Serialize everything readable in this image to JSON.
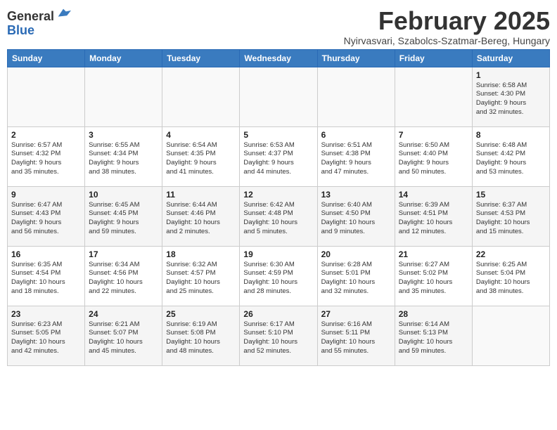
{
  "header": {
    "logo_general": "General",
    "logo_blue": "Blue",
    "month_title": "February 2025",
    "subtitle": "Nyirvasvari, Szabolcs-Szatmar-Bereg, Hungary"
  },
  "days_of_week": [
    "Sunday",
    "Monday",
    "Tuesday",
    "Wednesday",
    "Thursday",
    "Friday",
    "Saturday"
  ],
  "weeks": [
    [
      {
        "day": "",
        "info": ""
      },
      {
        "day": "",
        "info": ""
      },
      {
        "day": "",
        "info": ""
      },
      {
        "day": "",
        "info": ""
      },
      {
        "day": "",
        "info": ""
      },
      {
        "day": "",
        "info": ""
      },
      {
        "day": "1",
        "info": "Sunrise: 6:58 AM\nSunset: 4:30 PM\nDaylight: 9 hours\nand 32 minutes."
      }
    ],
    [
      {
        "day": "2",
        "info": "Sunrise: 6:57 AM\nSunset: 4:32 PM\nDaylight: 9 hours\nand 35 minutes."
      },
      {
        "day": "3",
        "info": "Sunrise: 6:55 AM\nSunset: 4:34 PM\nDaylight: 9 hours\nand 38 minutes."
      },
      {
        "day": "4",
        "info": "Sunrise: 6:54 AM\nSunset: 4:35 PM\nDaylight: 9 hours\nand 41 minutes."
      },
      {
        "day": "5",
        "info": "Sunrise: 6:53 AM\nSunset: 4:37 PM\nDaylight: 9 hours\nand 44 minutes."
      },
      {
        "day": "6",
        "info": "Sunrise: 6:51 AM\nSunset: 4:38 PM\nDaylight: 9 hours\nand 47 minutes."
      },
      {
        "day": "7",
        "info": "Sunrise: 6:50 AM\nSunset: 4:40 PM\nDaylight: 9 hours\nand 50 minutes."
      },
      {
        "day": "8",
        "info": "Sunrise: 6:48 AM\nSunset: 4:42 PM\nDaylight: 9 hours\nand 53 minutes."
      }
    ],
    [
      {
        "day": "9",
        "info": "Sunrise: 6:47 AM\nSunset: 4:43 PM\nDaylight: 9 hours\nand 56 minutes."
      },
      {
        "day": "10",
        "info": "Sunrise: 6:45 AM\nSunset: 4:45 PM\nDaylight: 9 hours\nand 59 minutes."
      },
      {
        "day": "11",
        "info": "Sunrise: 6:44 AM\nSunset: 4:46 PM\nDaylight: 10 hours\nand 2 minutes."
      },
      {
        "day": "12",
        "info": "Sunrise: 6:42 AM\nSunset: 4:48 PM\nDaylight: 10 hours\nand 5 minutes."
      },
      {
        "day": "13",
        "info": "Sunrise: 6:40 AM\nSunset: 4:50 PM\nDaylight: 10 hours\nand 9 minutes."
      },
      {
        "day": "14",
        "info": "Sunrise: 6:39 AM\nSunset: 4:51 PM\nDaylight: 10 hours\nand 12 minutes."
      },
      {
        "day": "15",
        "info": "Sunrise: 6:37 AM\nSunset: 4:53 PM\nDaylight: 10 hours\nand 15 minutes."
      }
    ],
    [
      {
        "day": "16",
        "info": "Sunrise: 6:35 AM\nSunset: 4:54 PM\nDaylight: 10 hours\nand 18 minutes."
      },
      {
        "day": "17",
        "info": "Sunrise: 6:34 AM\nSunset: 4:56 PM\nDaylight: 10 hours\nand 22 minutes."
      },
      {
        "day": "18",
        "info": "Sunrise: 6:32 AM\nSunset: 4:57 PM\nDaylight: 10 hours\nand 25 minutes."
      },
      {
        "day": "19",
        "info": "Sunrise: 6:30 AM\nSunset: 4:59 PM\nDaylight: 10 hours\nand 28 minutes."
      },
      {
        "day": "20",
        "info": "Sunrise: 6:28 AM\nSunset: 5:01 PM\nDaylight: 10 hours\nand 32 minutes."
      },
      {
        "day": "21",
        "info": "Sunrise: 6:27 AM\nSunset: 5:02 PM\nDaylight: 10 hours\nand 35 minutes."
      },
      {
        "day": "22",
        "info": "Sunrise: 6:25 AM\nSunset: 5:04 PM\nDaylight: 10 hours\nand 38 minutes."
      }
    ],
    [
      {
        "day": "23",
        "info": "Sunrise: 6:23 AM\nSunset: 5:05 PM\nDaylight: 10 hours\nand 42 minutes."
      },
      {
        "day": "24",
        "info": "Sunrise: 6:21 AM\nSunset: 5:07 PM\nDaylight: 10 hours\nand 45 minutes."
      },
      {
        "day": "25",
        "info": "Sunrise: 6:19 AM\nSunset: 5:08 PM\nDaylight: 10 hours\nand 48 minutes."
      },
      {
        "day": "26",
        "info": "Sunrise: 6:17 AM\nSunset: 5:10 PM\nDaylight: 10 hours\nand 52 minutes."
      },
      {
        "day": "27",
        "info": "Sunrise: 6:16 AM\nSunset: 5:11 PM\nDaylight: 10 hours\nand 55 minutes."
      },
      {
        "day": "28",
        "info": "Sunrise: 6:14 AM\nSunset: 5:13 PM\nDaylight: 10 hours\nand 59 minutes."
      },
      {
        "day": "",
        "info": ""
      }
    ]
  ]
}
